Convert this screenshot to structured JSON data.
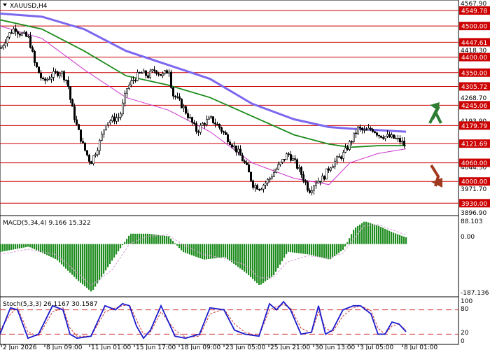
{
  "title": "XAUUSD,H4",
  "colors": {
    "candle": "#000000",
    "level": "#cc0000",
    "ma_fast": "#cc33cc",
    "ma_mid": "#1a8a1a",
    "ma_slow": "#7b68ee",
    "macd_hist": "#1e8c1e",
    "macd_signal": "#d4a0d4",
    "stoch_main": "#1a1acc",
    "stoch_signal": "#cc3333",
    "arrow_up": "#2e7d32",
    "arrow_down": "#a0391f"
  },
  "icons": {
    "dropdown": "triangle-down-icon",
    "up_arrow": "up-arrow-icon",
    "down_arrow": "down-arrow-icon"
  },
  "price_axis_labels": [
    "4567.90",
    "4418.30",
    "4268.70",
    "4193.90",
    "4044.30",
    "3971.70",
    "3896.90"
  ],
  "level_labels": [
    "4549.78",
    "4500.00",
    "4447.61",
    "4400.00",
    "4350.00",
    "4305.72",
    "4245.06",
    "4179.79",
    "4121.69",
    "4060.00",
    "4000.00",
    "3930.00"
  ],
  "macd": {
    "label": "MACD(5,34,4) 9.166 15.322",
    "axis_labels": [
      "88.103",
      "0.00",
      "-187.136"
    ]
  },
  "stoch": {
    "label": "Stoch(5,3,3) 26.1167 30.1587",
    "axis_labels": [
      "100",
      "80",
      "20",
      "0"
    ]
  },
  "time_labels": [
    "2 Jun 2026",
    "8 Jun 09:00",
    "11 Jun 01:00",
    "15 Jun 17:00",
    "18 Jun 09:00",
    "23 Jun 05:00",
    "25 Jun 21:00",
    "30 Jun 13:00",
    "3 Jul 05:00",
    "8 Jul 01:00"
  ],
  "chart_data": {
    "type": "candlestick",
    "symbol": "XAUUSD",
    "timeframe": "H4",
    "ylim": [
      3896.9,
      4567.9
    ],
    "levels": [
      4549.78,
      4500.0,
      4447.61,
      4400.0,
      4350.0,
      4305.72,
      4245.06,
      4179.79,
      4121.69,
      4060.0,
      4000.0,
      3930.0
    ],
    "close_path": [
      [
        0,
        4430
      ],
      [
        10,
        4470
      ],
      [
        20,
        4495
      ],
      [
        25,
        4480
      ],
      [
        40,
        4460
      ],
      [
        48,
        4380
      ],
      [
        60,
        4320
      ],
      [
        72,
        4340
      ],
      [
        85,
        4355
      ],
      [
        95,
        4320
      ],
      [
        100,
        4250
      ],
      [
        108,
        4180
      ],
      [
        118,
        4110
      ],
      [
        128,
        4060
      ],
      [
        140,
        4120
      ],
      [
        150,
        4190
      ],
      [
        160,
        4200
      ],
      [
        170,
        4210
      ],
      [
        180,
        4300
      ],
      [
        190,
        4330
      ],
      [
        200,
        4350
      ],
      [
        210,
        4340
      ],
      [
        220,
        4360
      ],
      [
        230,
        4340
      ],
      [
        240,
        4360
      ],
      [
        245,
        4280
      ],
      [
        250,
        4270
      ],
      [
        260,
        4240
      ],
      [
        270,
        4200
      ],
      [
        280,
        4160
      ],
      [
        290,
        4190
      ],
      [
        300,
        4200
      ],
      [
        310,
        4180
      ],
      [
        320,
        4150
      ],
      [
        330,
        4120
      ],
      [
        340,
        4090
      ],
      [
        350,
        4050
      ],
      [
        360,
        3990
      ],
      [
        370,
        3980
      ],
      [
        380,
        4000
      ],
      [
        390,
        4030
      ],
      [
        400,
        4060
      ],
      [
        410,
        4090
      ],
      [
        420,
        4060
      ],
      [
        430,
        4020
      ],
      [
        440,
        3970
      ],
      [
        450,
        4000
      ],
      [
        460,
        4010
      ],
      [
        470,
        4050
      ],
      [
        480,
        4070
      ],
      [
        490,
        4090
      ],
      [
        500,
        4130
      ],
      [
        510,
        4170
      ],
      [
        520,
        4160
      ],
      [
        530,
        4170
      ],
      [
        540,
        4150
      ],
      [
        550,
        4145
      ],
      [
        560,
        4140
      ],
      [
        570,
        4130
      ],
      [
        578,
        4115
      ]
    ],
    "moving_averages": [
      {
        "name": "",
        "color": "#cc33cc",
        "points": [
          [
            0,
            4500
          ],
          [
            60,
            4460
          ],
          [
            120,
            4360
          ],
          [
            180,
            4270
          ],
          [
            240,
            4230
          ],
          [
            300,
            4160
          ],
          [
            360,
            4060
          ],
          [
            420,
            4010
          ],
          [
            470,
            3990
          ],
          [
            500,
            4060
          ],
          [
            540,
            4090
          ],
          [
            580,
            4105
          ]
        ]
      },
      {
        "name": "",
        "color": "#1a8a1a",
        "points": [
          [
            0,
            4520
          ],
          [
            60,
            4490
          ],
          [
            120,
            4420
          ],
          [
            180,
            4340
          ],
          [
            240,
            4310
          ],
          [
            300,
            4270
          ],
          [
            360,
            4210
          ],
          [
            420,
            4150
          ],
          [
            470,
            4120
          ],
          [
            500,
            4110
          ],
          [
            540,
            4115
          ],
          [
            580,
            4115
          ]
        ]
      },
      {
        "name": "",
        "color": "#7b68ee",
        "points": [
          [
            0,
            4540
          ],
          [
            60,
            4530
          ],
          [
            120,
            4490
          ],
          [
            180,
            4420
          ],
          [
            240,
            4375
          ],
          [
            300,
            4330
          ],
          [
            360,
            4250
          ],
          [
            420,
            4200
          ],
          [
            470,
            4175
          ],
          [
            500,
            4170
          ],
          [
            540,
            4165
          ],
          [
            580,
            4160
          ]
        ]
      }
    ],
    "macd": {
      "ylim": [
        -187.136,
        88.103
      ],
      "histogram_path": [
        [
          0,
          -30
        ],
        [
          40,
          -10
        ],
        [
          80,
          -60
        ],
        [
          110,
          -140
        ],
        [
          130,
          -185
        ],
        [
          160,
          -60
        ],
        [
          185,
          40
        ],
        [
          210,
          40
        ],
        [
          240,
          30
        ],
        [
          260,
          -30
        ],
        [
          290,
          -60
        ],
        [
          320,
          -50
        ],
        [
          350,
          -110
        ],
        [
          370,
          -160
        ],
        [
          390,
          -120
        ],
        [
          410,
          -30
        ],
        [
          440,
          -40
        ],
        [
          470,
          -60
        ],
        [
          490,
          -20
        ],
        [
          505,
          60
        ],
        [
          520,
          88
        ],
        [
          540,
          70
        ],
        [
          560,
          45
        ],
        [
          580,
          25
        ]
      ],
      "signal_path": [
        [
          0,
          -40
        ],
        [
          40,
          -20
        ],
        [
          80,
          -40
        ],
        [
          110,
          -110
        ],
        [
          130,
          -160
        ],
        [
          160,
          -100
        ],
        [
          185,
          0
        ],
        [
          210,
          30
        ],
        [
          240,
          35
        ],
        [
          260,
          0
        ],
        [
          290,
          -40
        ],
        [
          320,
          -55
        ],
        [
          350,
          -80
        ],
        [
          370,
          -130
        ],
        [
          390,
          -130
        ],
        [
          410,
          -70
        ],
        [
          440,
          -45
        ],
        [
          470,
          -55
        ],
        [
          490,
          -35
        ],
        [
          505,
          20
        ],
        [
          520,
          70
        ],
        [
          540,
          75
        ],
        [
          560,
          55
        ],
        [
          580,
          35
        ]
      ]
    },
    "stochastic": {
      "ylim": [
        0,
        100
      ],
      "levels": [
        80,
        20
      ],
      "main_path": [
        [
          0,
          20
        ],
        [
          15,
          85
        ],
        [
          25,
          80
        ],
        [
          40,
          10
        ],
        [
          55,
          20
        ],
        [
          75,
          90
        ],
        [
          90,
          80
        ],
        [
          100,
          20
        ],
        [
          110,
          10
        ],
        [
          130,
          15
        ],
        [
          150,
          90
        ],
        [
          165,
          80
        ],
        [
          175,
          95
        ],
        [
          185,
          90
        ],
        [
          195,
          40
        ],
        [
          205,
          10
        ],
        [
          215,
          30
        ],
        [
          230,
          90
        ],
        [
          250,
          15
        ],
        [
          265,
          10
        ],
        [
          285,
          20
        ],
        [
          300,
          85
        ],
        [
          320,
          80
        ],
        [
          335,
          30
        ],
        [
          350,
          20
        ],
        [
          370,
          15
        ],
        [
          385,
          95
        ],
        [
          395,
          80
        ],
        [
          405,
          100
        ],
        [
          415,
          80
        ],
        [
          430,
          20
        ],
        [
          445,
          25
        ],
        [
          455,
          90
        ],
        [
          465,
          20
        ],
        [
          475,
          30
        ],
        [
          490,
          80
        ],
        [
          505,
          90
        ],
        [
          515,
          90
        ],
        [
          530,
          70
        ],
        [
          540,
          20
        ],
        [
          550,
          20
        ],
        [
          560,
          50
        ],
        [
          570,
          45
        ],
        [
          580,
          26
        ]
      ],
      "signal_path": [
        [
          0,
          30
        ],
        [
          15,
          70
        ],
        [
          25,
          85
        ],
        [
          40,
          25
        ],
        [
          55,
          15
        ],
        [
          75,
          75
        ],
        [
          90,
          85
        ],
        [
          100,
          35
        ],
        [
          110,
          15
        ],
        [
          130,
          15
        ],
        [
          150,
          75
        ],
        [
          165,
          85
        ],
        [
          175,
          90
        ],
        [
          185,
          92
        ],
        [
          195,
          55
        ],
        [
          205,
          20
        ],
        [
          215,
          25
        ],
        [
          230,
          75
        ],
        [
          250,
          30
        ],
        [
          265,
          12
        ],
        [
          285,
          15
        ],
        [
          300,
          70
        ],
        [
          320,
          82
        ],
        [
          335,
          45
        ],
        [
          350,
          25
        ],
        [
          370,
          15
        ],
        [
          385,
          80
        ],
        [
          395,
          88
        ],
        [
          405,
          93
        ],
        [
          415,
          85
        ],
        [
          430,
          35
        ],
        [
          445,
          22
        ],
        [
          455,
          75
        ],
        [
          465,
          35
        ],
        [
          475,
          25
        ],
        [
          490,
          65
        ],
        [
          505,
          85
        ],
        [
          515,
          90
        ],
        [
          530,
          78
        ],
        [
          540,
          35
        ],
        [
          550,
          20
        ],
        [
          560,
          40
        ],
        [
          570,
          45
        ],
        [
          580,
          30
        ]
      ]
    }
  }
}
